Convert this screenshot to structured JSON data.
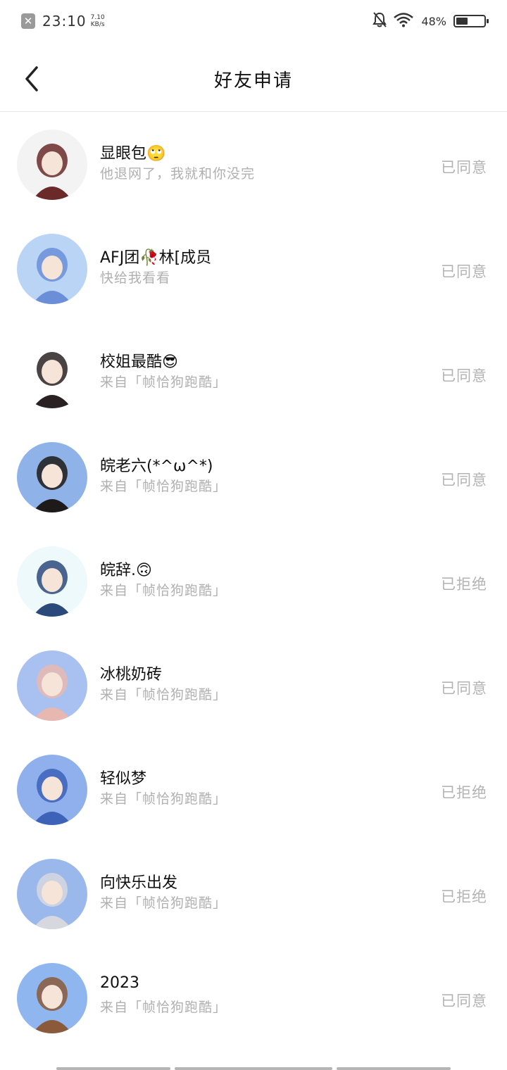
{
  "status_bar": {
    "time": "23:10",
    "speed_value": "7.10",
    "speed_unit": "KB/s",
    "battery_percent_text": "48%",
    "battery_level": 0.48
  },
  "header": {
    "title": "好友申请"
  },
  "requests": [
    {
      "name": "显眼包🙄",
      "message": "他退网了，我就和你没完",
      "status": "已同意",
      "avatar_color": "#f3f3f3",
      "avatar_accent": "#6b2a2a"
    },
    {
      "name": "AFJ团🥀林[成员",
      "message": "快给我看看",
      "status": "已同意",
      "avatar_color": "#b9d4f5",
      "avatar_accent": "#6a8fd8"
    },
    {
      "name": "校姐最酷😎",
      "message": "来自「帧恰狗跑酷」",
      "status": "已同意",
      "avatar_color": "#ffffff",
      "avatar_accent": "#2a2222"
    },
    {
      "name": "皖老六(*^ω^*)",
      "message": "来自「帧恰狗跑酷」",
      "status": "已同意",
      "avatar_color": "#8fb3e8",
      "avatar_accent": "#1e1a1a"
    },
    {
      "name": "皖辞.🙃",
      "message": "来自「帧恰狗跑酷」",
      "status": "已拒绝",
      "avatar_color": "#eef9fb",
      "avatar_accent": "#2b4a7a"
    },
    {
      "name": "冰桃奶砖",
      "message": "来自「帧恰狗跑酷」",
      "status": "已同意",
      "avatar_color": "#a9c1f0",
      "avatar_accent": "#e8b8b0"
    },
    {
      "name": "轻似梦",
      "message": "来自「帧恰狗跑酷」",
      "status": "已拒绝",
      "avatar_color": "#8fb0ec",
      "avatar_accent": "#3d62b8"
    },
    {
      "name": "向快乐出发",
      "message": "来自「帧恰狗跑酷」",
      "status": "已拒绝",
      "avatar_color": "#9bb8ec",
      "avatar_accent": "#d7d7df"
    },
    {
      "name": "2023",
      "message": "来自「帧恰狗跑酷」",
      "status": "已同意",
      "avatar_color": "#8fb6ee",
      "avatar_accent": "#8a5a3a"
    }
  ]
}
